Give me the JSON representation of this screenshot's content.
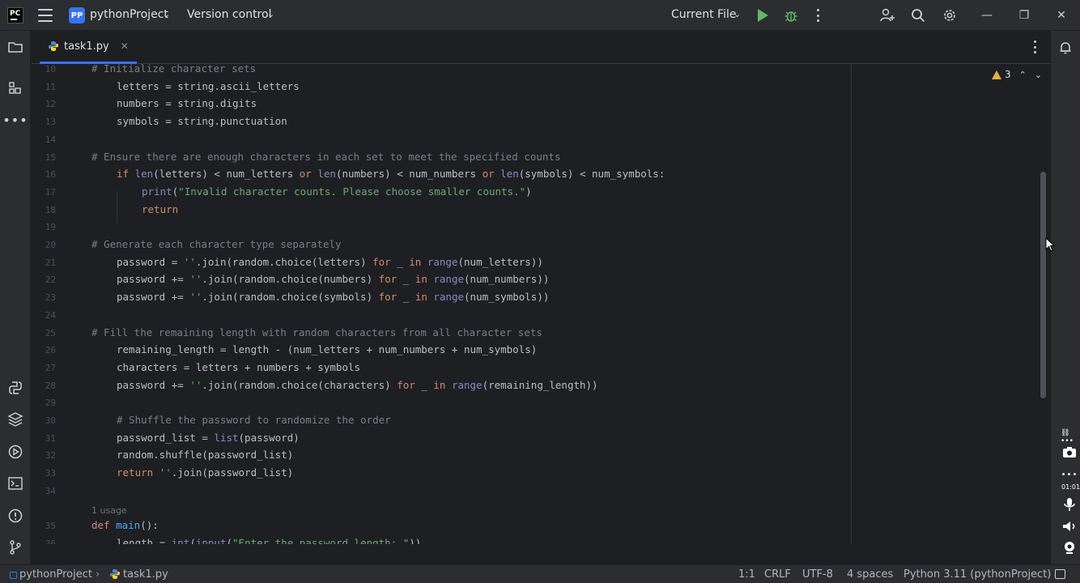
{
  "titlebar": {
    "app_logo": "PC",
    "project_badge": "PP",
    "project_name": "pythonProject",
    "version_control": "Version control",
    "run_config": "Current File"
  },
  "tab": {
    "label": "task1.py"
  },
  "inspection": {
    "warning_count": "3"
  },
  "editor": {
    "lines": [
      {
        "n": "10",
        "indent": 0,
        "parts": [
          [
            "cm",
            "# Initialize character sets"
          ]
        ]
      },
      {
        "n": "11",
        "indent": 1,
        "parts": [
          [
            "",
            "letters = string.ascii_letters"
          ]
        ]
      },
      {
        "n": "12",
        "indent": 1,
        "parts": [
          [
            "",
            "numbers = string.digits"
          ]
        ]
      },
      {
        "n": "13",
        "indent": 1,
        "parts": [
          [
            "",
            "symbols = string.punctuation"
          ]
        ]
      },
      {
        "n": "14",
        "indent": 0,
        "parts": []
      },
      {
        "n": "15",
        "indent": 0,
        "parts": [
          [
            "cm",
            "# Ensure there are enough characters in each set to meet the specified counts"
          ]
        ]
      },
      {
        "n": "16",
        "indent": 1,
        "parts": [
          [
            "kw",
            "if "
          ],
          [
            "bi",
            "len"
          ],
          [
            "",
            "(letters) < num_letters "
          ],
          [
            "kw",
            "or "
          ],
          [
            "bi",
            "len"
          ],
          [
            "",
            "(numbers) < num_numbers "
          ],
          [
            "kw",
            "or "
          ],
          [
            "bi",
            "len"
          ],
          [
            "",
            "(symbols) < num_symbols:"
          ]
        ]
      },
      {
        "n": "17",
        "indent": 2,
        "parts": [
          [
            "bi",
            "print"
          ],
          [
            "",
            "("
          ],
          [
            "str",
            "\"Invalid character counts. Please choose smaller counts.\""
          ],
          [
            "",
            ")"
          ]
        ]
      },
      {
        "n": "18",
        "indent": 2,
        "parts": [
          [
            "kw",
            "return"
          ]
        ]
      },
      {
        "n": "19",
        "indent": 0,
        "parts": []
      },
      {
        "n": "20",
        "indent": 0,
        "parts": [
          [
            "cm",
            "# Generate each character type separately"
          ]
        ]
      },
      {
        "n": "21",
        "indent": 1,
        "parts": [
          [
            "",
            "password = "
          ],
          [
            "str",
            "''"
          ],
          [
            "",
            ".join(random.choice(letters) "
          ],
          [
            "kw",
            "for "
          ],
          [
            "",
            "_ "
          ],
          [
            "kw",
            "in "
          ],
          [
            "bi",
            "range"
          ],
          [
            "",
            "(num_letters))"
          ]
        ]
      },
      {
        "n": "22",
        "indent": 1,
        "parts": [
          [
            "",
            "password += "
          ],
          [
            "str",
            "''"
          ],
          [
            "",
            ".join(random.choice(numbers) "
          ],
          [
            "kw",
            "for "
          ],
          [
            "",
            "_ "
          ],
          [
            "kw",
            "in "
          ],
          [
            "bi",
            "range"
          ],
          [
            "",
            "(num_numbers))"
          ]
        ]
      },
      {
        "n": "23",
        "indent": 1,
        "parts": [
          [
            "",
            "password += "
          ],
          [
            "str",
            "''"
          ],
          [
            "",
            ".join(random.choice(symbols) "
          ],
          [
            "kw",
            "for "
          ],
          [
            "",
            "_ "
          ],
          [
            "kw",
            "in "
          ],
          [
            "bi",
            "range"
          ],
          [
            "",
            "(num_symbols))"
          ]
        ]
      },
      {
        "n": "24",
        "indent": 0,
        "parts": []
      },
      {
        "n": "25",
        "indent": 0,
        "parts": [
          [
            "cm",
            "# Fill the remaining length with random characters from all character sets"
          ]
        ]
      },
      {
        "n": "26",
        "indent": 1,
        "parts": [
          [
            "",
            "remaining_length = length - (num_letters + num_numbers + num_symbols)"
          ]
        ]
      },
      {
        "n": "27",
        "indent": 1,
        "parts": [
          [
            "",
            "characters = letters + numbers + symbols"
          ]
        ]
      },
      {
        "n": "28",
        "indent": 1,
        "parts": [
          [
            "",
            "password += "
          ],
          [
            "str",
            "''"
          ],
          [
            "",
            ".join(random.choice(characters) "
          ],
          [
            "kw",
            "for "
          ],
          [
            "",
            "_ "
          ],
          [
            "kw",
            "in "
          ],
          [
            "bi",
            "range"
          ],
          [
            "",
            "(remaining_length))"
          ]
        ]
      },
      {
        "n": "29",
        "indent": 0,
        "parts": []
      },
      {
        "n": "30",
        "indent": 1,
        "parts": [
          [
            "cm",
            "# Shuffle the password to randomize the order"
          ]
        ]
      },
      {
        "n": "31",
        "indent": 1,
        "parts": [
          [
            "",
            "password_list = "
          ],
          [
            "bi",
            "list"
          ],
          [
            "",
            "(password)"
          ]
        ]
      },
      {
        "n": "32",
        "indent": 1,
        "parts": [
          [
            "",
            "random.shuffle(password_list)"
          ]
        ]
      },
      {
        "n": "33",
        "indent": 1,
        "parts": [
          [
            "kw",
            "return "
          ],
          [
            "str",
            "''"
          ],
          [
            "",
            ".join(password_list)"
          ]
        ]
      },
      {
        "n": "34",
        "indent": 0,
        "parts": []
      },
      {
        "n": "",
        "indent": 0,
        "usage": "1 usage",
        "parts": []
      },
      {
        "n": "35",
        "indent": 0,
        "parts": [
          [
            "kw",
            "def "
          ],
          [
            "fn",
            "main"
          ],
          [
            "",
            "():"
          ]
        ]
      },
      {
        "n": "36",
        "indent": 1,
        "parts": [
          [
            "",
            "length = "
          ],
          [
            "bi",
            "int"
          ],
          [
            "",
            "("
          ],
          [
            "bi",
            "input"
          ],
          [
            "",
            "("
          ],
          [
            "str",
            "\"Enter the password length: \""
          ],
          [
            "",
            "))"
          ]
        ]
      }
    ]
  },
  "statusbar": {
    "breadcrumb_project": "pythonProject",
    "breadcrumb_file": "task1.py",
    "position": "1:1",
    "line_sep": "CRLF",
    "encoding": "UTF-8",
    "indent": "4 spaces",
    "interpreter": "Python 3.11 (pythonProject)"
  },
  "overlay": {
    "time": "01:01"
  },
  "colors": {
    "accent": "#3574f0",
    "run": "#5fb865",
    "debug": "#5fb865",
    "warning": "#e0b048",
    "comment": "#7a7e85",
    "keyword": "#cf8e6d",
    "builtin": "#8888c6",
    "string": "#6aab73"
  }
}
